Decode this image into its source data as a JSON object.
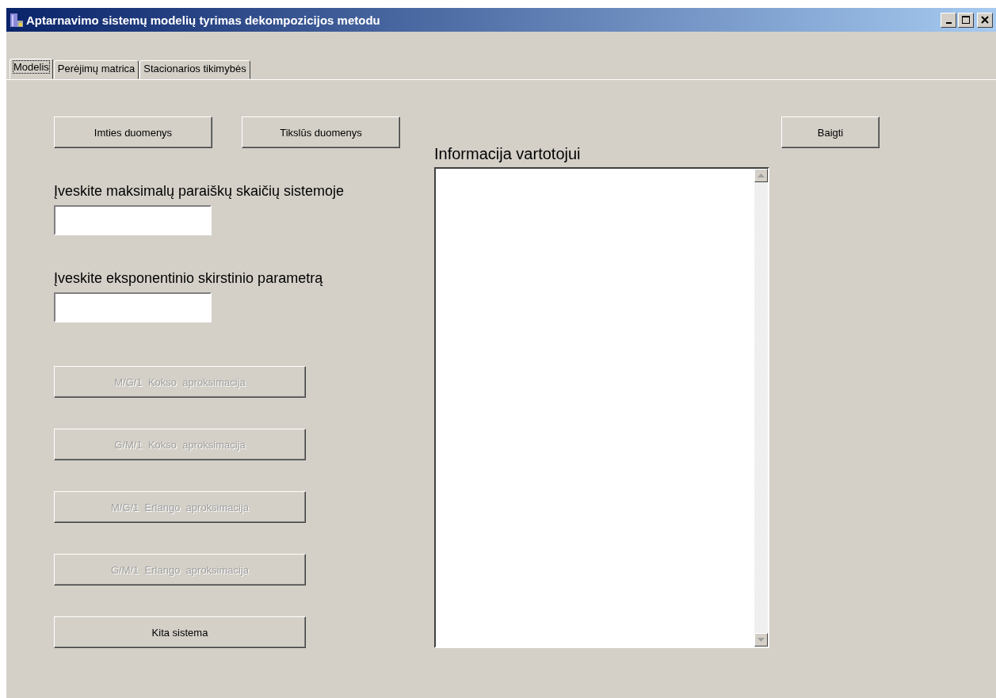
{
  "window": {
    "title": "Aptarnavimo sistemų modelių tyrimas dekompozicijos metodu"
  },
  "tabs": [
    {
      "label": "Modelis",
      "selected": true
    },
    {
      "label": "Perėjimų matrica",
      "selected": false
    },
    {
      "label": "Stacionarios tikimybės",
      "selected": false
    }
  ],
  "data_buttons": [
    {
      "label": "Imties duomenys",
      "disabled": false
    },
    {
      "label": "Tikslūs duomenys",
      "disabled": false
    }
  ],
  "fields": [
    {
      "label": "Įveskite maksimalų paraiškų skaičių sistemoje"
    },
    {
      "label": "Įveskite eksponentinio skirstinio parametrą"
    }
  ],
  "method_buttons": [
    {
      "label": "M/G/1  Kokso  aproksimacija",
      "disabled": true
    },
    {
      "label": "G/M/1  Kokso  aproksimacija",
      "disabled": true
    },
    {
      "label": "M/G/1  Erlango  aproksimacija",
      "disabled": true
    },
    {
      "label": "G/M/1  Erlango  aproksimacija",
      "disabled": true
    },
    {
      "label": "Kita sistema",
      "disabled": false
    }
  ],
  "info": {
    "label": "Informacija vartotojui"
  },
  "exit_button": {
    "label": "Baigti",
    "disabled": false
  }
}
